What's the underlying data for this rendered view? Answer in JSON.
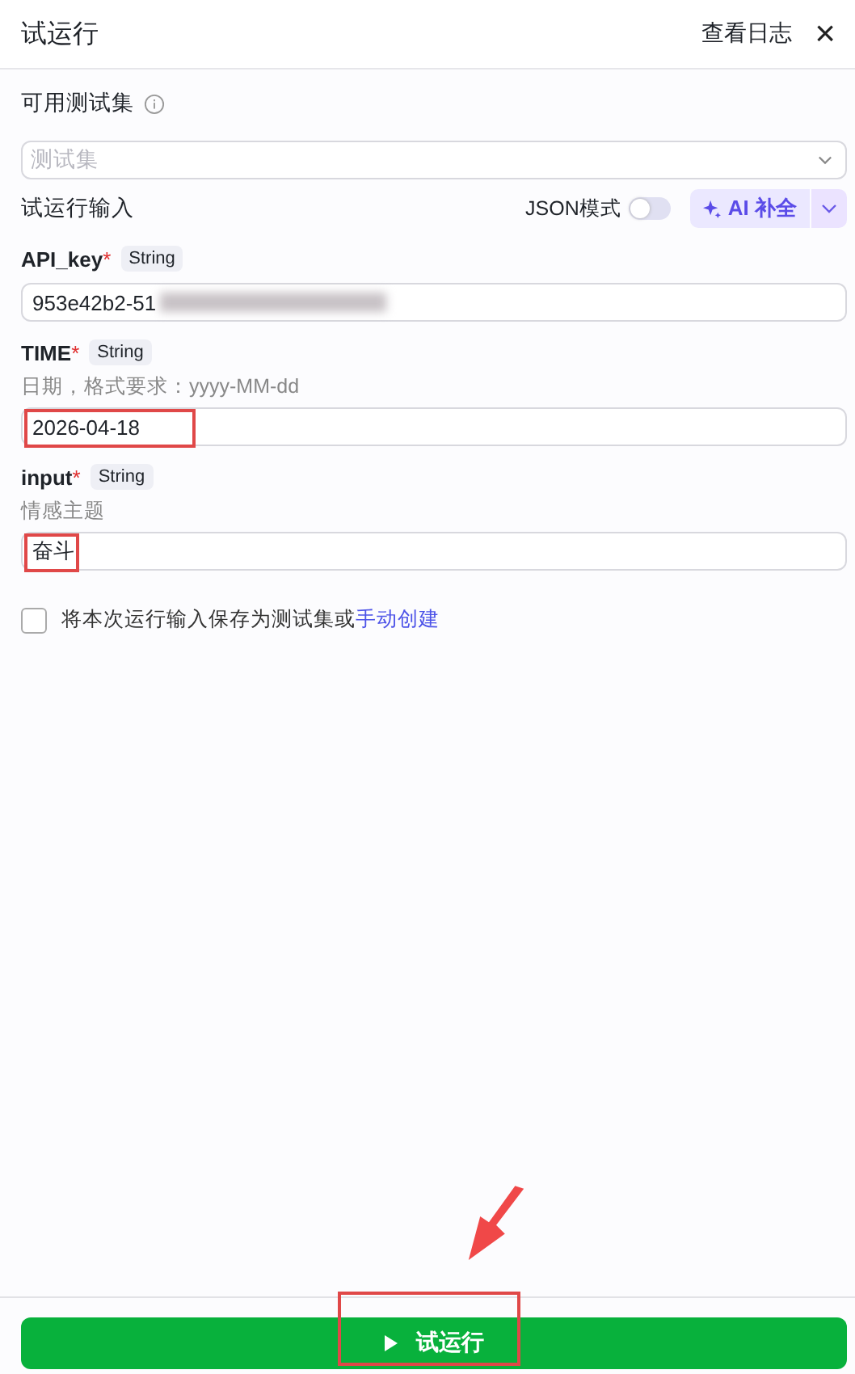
{
  "header": {
    "title": "试运行",
    "log_link": "查看日志",
    "close": "×"
  },
  "testset": {
    "label": "可用测试集",
    "placeholder": "测试集"
  },
  "input_section": {
    "title": "试运行输入",
    "json_mode": {
      "label": "JSON模式",
      "on": false
    },
    "ai_button": "AI 补全"
  },
  "fields": [
    {
      "name": "API_key",
      "required_mark": "*",
      "type": "String",
      "value": "953e42b2-51",
      "redacted": true
    },
    {
      "name": "TIME",
      "required_mark": "*",
      "type": "String",
      "description": "日期，格式要求：yyyy-MM-dd",
      "value": "2026-04-18",
      "highlighted": true
    },
    {
      "name": "input",
      "required_mark": "*",
      "type": "String",
      "description": "情感主题",
      "value": "奋斗",
      "highlighted": true
    }
  ],
  "save_option": {
    "checked": false,
    "text": "将本次运行输入保存为测试集或",
    "link": "手动创建"
  },
  "run_button": {
    "label": "试运行",
    "highlighted": true,
    "arrow": true
  }
}
